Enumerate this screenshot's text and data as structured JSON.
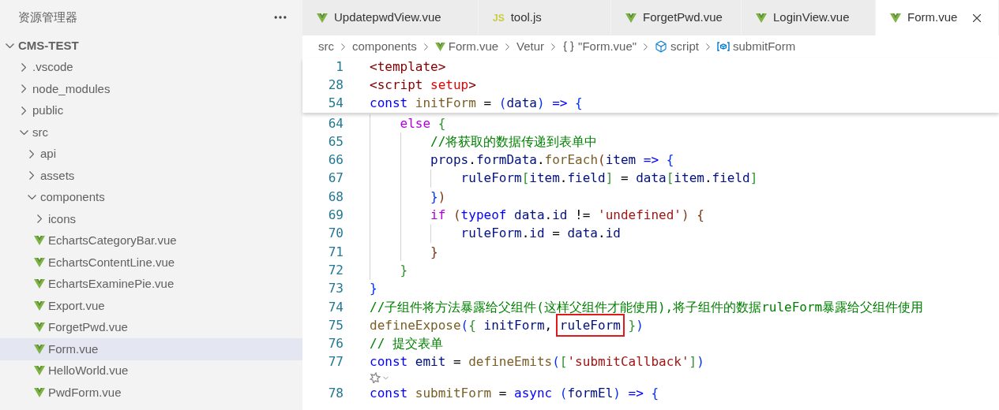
{
  "sidebar": {
    "title": "资源管理器",
    "tree": [
      {
        "label": "CMS-TEST",
        "kind": "root",
        "expanded": true,
        "selected": false,
        "children": [
          {
            "label": ".vscode",
            "kind": "folder",
            "expanded": false,
            "selected": false
          },
          {
            "label": "node_modules",
            "kind": "folder",
            "expanded": false,
            "selected": false
          },
          {
            "label": "public",
            "kind": "folder",
            "expanded": false,
            "selected": false
          },
          {
            "label": "src",
            "kind": "folder",
            "expanded": true,
            "selected": false,
            "children": [
              {
                "label": "api",
                "kind": "folder",
                "expanded": false,
                "selected": false
              },
              {
                "label": "assets",
                "kind": "folder",
                "expanded": false,
                "selected": false
              },
              {
                "label": "components",
                "kind": "folder",
                "expanded": true,
                "selected": false,
                "children": [
                  {
                    "label": "icons",
                    "kind": "folder",
                    "expanded": false,
                    "selected": false
                  },
                  {
                    "label": "EchartsCategoryBar.vue",
                    "kind": "vue",
                    "selected": false
                  },
                  {
                    "label": "EchartsContentLine.vue",
                    "kind": "vue",
                    "selected": false
                  },
                  {
                    "label": "EchartsExaminePie.vue",
                    "kind": "vue",
                    "selected": false
                  },
                  {
                    "label": "Export.vue",
                    "kind": "vue",
                    "selected": false
                  },
                  {
                    "label": "ForgetPwd.vue",
                    "kind": "vue",
                    "selected": false
                  },
                  {
                    "label": "Form.vue",
                    "kind": "vue",
                    "selected": true
                  },
                  {
                    "label": "HelloWorld.vue",
                    "kind": "vue",
                    "selected": false
                  },
                  {
                    "label": "PwdForm.vue",
                    "kind": "vue",
                    "selected": false
                  }
                ]
              }
            ]
          }
        ]
      }
    ]
  },
  "tabs": [
    {
      "label": "UpdatepwdView.vue",
      "kind": "vue",
      "selected": false
    },
    {
      "label": "tool.js",
      "kind": "js",
      "badge": "JS",
      "selected": false
    },
    {
      "label": "ForgetPwd.vue",
      "kind": "vue",
      "selected": false
    },
    {
      "label": "LoginView.vue",
      "kind": "vue",
      "selected": false
    },
    {
      "label": "Form.vue",
      "kind": "vue",
      "selected": true
    }
  ],
  "breadcrumbs": [
    {
      "label": "src",
      "kind": "plain"
    },
    {
      "label": "components",
      "kind": "plain"
    },
    {
      "label": "Form.vue",
      "kind": "vue"
    },
    {
      "label": "Vetur",
      "kind": "plain"
    },
    {
      "label": "\"Form.vue\"",
      "kind": "braces"
    },
    {
      "label": "script",
      "kind": "cube"
    },
    {
      "label": "submitForm",
      "kind": "variable"
    }
  ],
  "sticky_lines": [
    {
      "number": "1",
      "tokens": [
        {
          "text": "<template>",
          "kind": "tag"
        }
      ]
    },
    {
      "number": "28",
      "tokens": [
        {
          "text": "<script ",
          "kind": "tag"
        },
        {
          "text": "setup",
          "kind": "attr"
        },
        {
          "text": ">",
          "kind": "tag"
        }
      ]
    },
    {
      "number": "54",
      "tokens": [
        {
          "text": "const ",
          "kind": "kw"
        },
        {
          "text": "initForm",
          "kind": "fn"
        },
        {
          "text": " = ",
          "kind": "p"
        },
        {
          "text": "(",
          "kind": "b1"
        },
        {
          "text": "data",
          "kind": "var"
        },
        {
          "text": ")",
          "kind": "b1"
        },
        {
          "text": " => ",
          "kind": "kw"
        },
        {
          "text": "{",
          "kind": "b1"
        }
      ]
    }
  ],
  "lines": [
    {
      "kind": "code",
      "number": "64",
      "tokens": [
        {
          "text": "    else ",
          "kind": "ctl"
        },
        {
          "text": "{",
          "kind": "b2"
        }
      ]
    },
    {
      "kind": "code",
      "number": "65",
      "tokens": [
        {
          "text": "        //将获取的数据传递到表单中",
          "kind": "cmt"
        }
      ]
    },
    {
      "kind": "code",
      "number": "66",
      "tokens": [
        {
          "text": "        props",
          "kind": "var"
        },
        {
          "text": ".",
          "kind": "p"
        },
        {
          "text": "formData",
          "kind": "var"
        },
        {
          "text": ".",
          "kind": "p"
        },
        {
          "text": "forEach",
          "kind": "fn"
        },
        {
          "text": "(",
          "kind": "b3"
        },
        {
          "text": "item",
          "kind": "var"
        },
        {
          "text": " => ",
          "kind": "kw"
        },
        {
          "text": "{",
          "kind": "b1"
        }
      ]
    },
    {
      "kind": "code",
      "number": "67",
      "tokens": [
        {
          "text": "            ruleForm",
          "kind": "var"
        },
        {
          "text": "[",
          "kind": "b2"
        },
        {
          "text": "item",
          "kind": "var"
        },
        {
          "text": ".",
          "kind": "p"
        },
        {
          "text": "field",
          "kind": "var"
        },
        {
          "text": "]",
          "kind": "b2"
        },
        {
          "text": " = ",
          "kind": "p"
        },
        {
          "text": "data",
          "kind": "var"
        },
        {
          "text": "[",
          "kind": "b2"
        },
        {
          "text": "item",
          "kind": "var"
        },
        {
          "text": ".",
          "kind": "p"
        },
        {
          "text": "field",
          "kind": "var"
        },
        {
          "text": "]",
          "kind": "b2"
        }
      ]
    },
    {
      "kind": "code",
      "number": "68",
      "tokens": [
        {
          "text": "        }",
          "kind": "b1"
        },
        {
          "text": ")",
          "kind": "b3"
        }
      ]
    },
    {
      "kind": "code",
      "number": "69",
      "tokens": [
        {
          "text": "        if ",
          "kind": "ctl"
        },
        {
          "text": "(",
          "kind": "b3"
        },
        {
          "text": "typeof ",
          "kind": "kw"
        },
        {
          "text": "data",
          "kind": "var"
        },
        {
          "text": ".",
          "kind": "p"
        },
        {
          "text": "id",
          "kind": "var"
        },
        {
          "text": " != ",
          "kind": "p"
        },
        {
          "text": "'undefined'",
          "kind": "str"
        },
        {
          "text": ") {",
          "kind": "b3"
        }
      ]
    },
    {
      "kind": "code",
      "number": "70",
      "tokens": [
        {
          "text": "            ruleForm",
          "kind": "var"
        },
        {
          "text": ".",
          "kind": "p"
        },
        {
          "text": "id",
          "kind": "var"
        },
        {
          "text": " = ",
          "kind": "p"
        },
        {
          "text": "data",
          "kind": "var"
        },
        {
          "text": ".",
          "kind": "p"
        },
        {
          "text": "id",
          "kind": "var"
        }
      ]
    },
    {
      "kind": "code",
      "number": "71",
      "tokens": [
        {
          "text": "        }",
          "kind": "b3"
        }
      ]
    },
    {
      "kind": "code",
      "number": "72",
      "tokens": [
        {
          "text": "    }",
          "kind": "b2"
        }
      ]
    },
    {
      "kind": "code",
      "number": "73",
      "tokens": [
        {
          "text": "}",
          "kind": "b1"
        }
      ]
    },
    {
      "kind": "code",
      "number": "74",
      "tokens": [
        {
          "text": "//子组件将方法暴露给父组件(这样父组件才能使用),将子组件的数据ruleForm暴露给父组件使用",
          "kind": "cmt"
        }
      ]
    },
    {
      "kind": "code",
      "number": "75",
      "tokens": [
        {
          "text": "defineExpose",
          "kind": "fn"
        },
        {
          "text": "(",
          "kind": "b1"
        },
        {
          "text": "{ ",
          "kind": "b2"
        },
        {
          "text": "initForm",
          "kind": "var"
        },
        {
          "text": ", ",
          "kind": "p"
        },
        {
          "text": "ruleForm",
          "kind": "boxed"
        },
        {
          "text": " }",
          "kind": "b2"
        },
        {
          "text": ")",
          "kind": "b1"
        }
      ]
    },
    {
      "kind": "code",
      "number": "76",
      "tokens": [
        {
          "text": "// 提交表单",
          "kind": "cmt"
        }
      ]
    },
    {
      "kind": "code",
      "number": "77",
      "tokens": [
        {
          "text": "const ",
          "kind": "kw"
        },
        {
          "text": "emit",
          "kind": "var"
        },
        {
          "text": " = ",
          "kind": "p"
        },
        {
          "text": "defineEmits",
          "kind": "fn"
        },
        {
          "text": "(",
          "kind": "b1"
        },
        {
          "text": "[",
          "kind": "b2"
        },
        {
          "text": "'submitCallback'",
          "kind": "str"
        },
        {
          "text": "]",
          "kind": "b2"
        },
        {
          "text": ")",
          "kind": "b1"
        }
      ]
    },
    {
      "kind": "codelens"
    },
    {
      "kind": "code",
      "number": "78",
      "tokens": [
        {
          "text": "const ",
          "kind": "kw"
        },
        {
          "text": "submitForm",
          "kind": "fn"
        },
        {
          "text": " = ",
          "kind": "p"
        },
        {
          "text": "async ",
          "kind": "kw"
        },
        {
          "text": "(",
          "kind": "b1"
        },
        {
          "text": "formEl",
          "kind": "var"
        },
        {
          "text": ")",
          "kind": "b1"
        },
        {
          "text": " => ",
          "kind": "kw"
        },
        {
          "text": "{",
          "kind": "b1"
        }
      ]
    }
  ]
}
